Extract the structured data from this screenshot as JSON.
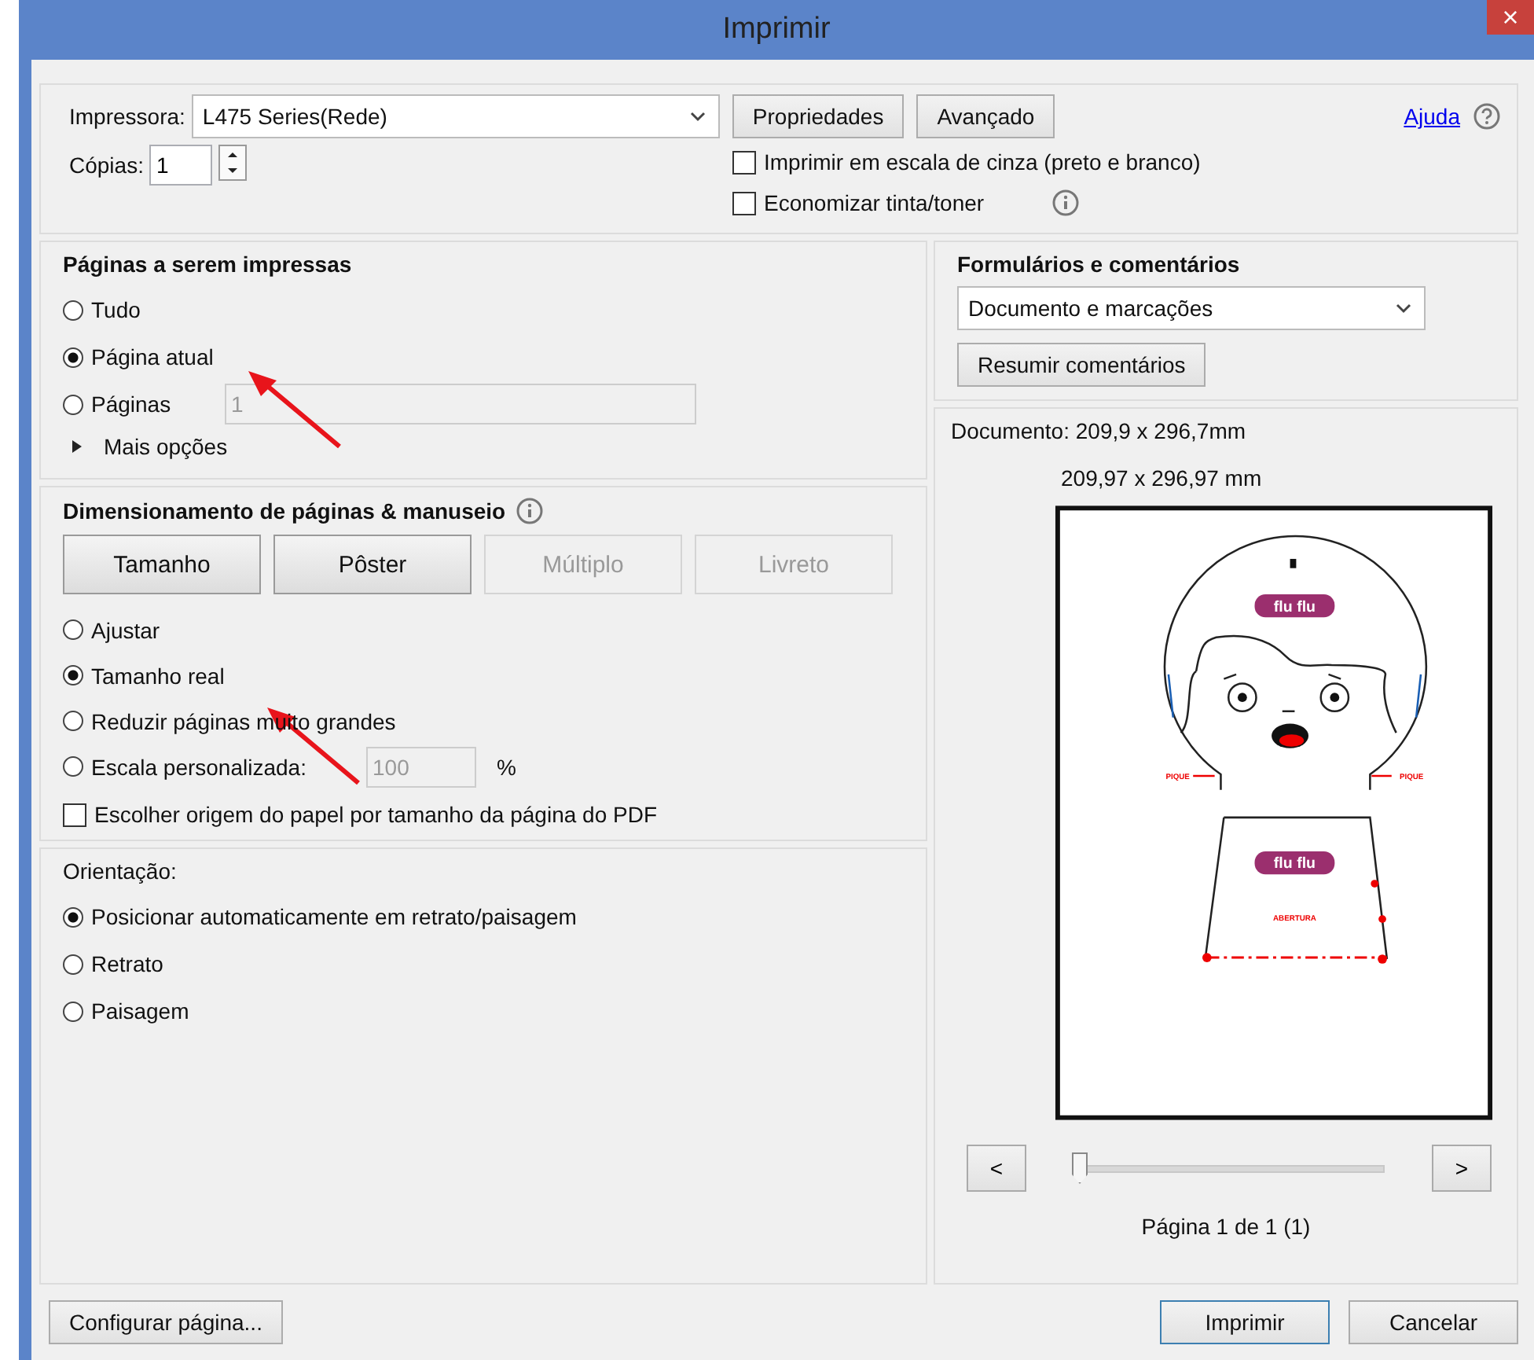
{
  "window": {
    "title": "Imprimir",
    "close": "×"
  },
  "printer": {
    "label": "Impressora:",
    "value": "L475 Series(Rede)",
    "buttons": [
      "Propriedades",
      "Avançado"
    ],
    "help": "Ajuda"
  },
  "copies": {
    "label": "Cópias:",
    "value": "1"
  },
  "options": [
    {
      "label": "Imprimir em escala de cinza (preto e branco)",
      "checked": false,
      "info": false
    },
    {
      "label": "Economizar tinta/toner",
      "checked": false,
      "info": true
    }
  ],
  "pages": {
    "title": "Páginas a serem impressas",
    "options": [
      {
        "label": "Tudo",
        "selected": false
      },
      {
        "label": "Página atual",
        "selected": true
      },
      {
        "label": "Páginas",
        "selected": false,
        "field": "1"
      }
    ],
    "more": "Mais opções",
    "expanded": false
  },
  "sizing": {
    "title": "Dimensionamento de páginas & manuseio",
    "buttons": [
      {
        "label": "Tamanho",
        "disabled": false
      },
      {
        "label": "Pôster",
        "disabled": false
      },
      {
        "label": "Múltiplo",
        "disabled": true
      },
      {
        "label": "Livreto",
        "disabled": true
      }
    ],
    "options": [
      {
        "label": "Ajustar",
        "selected": false
      },
      {
        "label": "Tamanho real",
        "selected": true
      },
      {
        "label": "Reduzir páginas muito grandes",
        "selected": false
      },
      {
        "label": "Escala personalizada:",
        "selected": false,
        "field": "100",
        "unit": "%"
      }
    ],
    "paper_source": {
      "label": "Escolher origem do papel por tamanho da página do PDF",
      "checked": false
    }
  },
  "orientation": {
    "title": "Orientação:",
    "options": [
      {
        "label": "Posicionar automaticamente em retrato/paisagem",
        "selected": true
      },
      {
        "label": "Retrato",
        "selected": false
      },
      {
        "label": "Paisagem",
        "selected": false
      }
    ]
  },
  "forms": {
    "title": "Formulários e comentários",
    "value": "Documento e marcações",
    "button": "Resumir comentários"
  },
  "preview": {
    "document": "Documento: 209,9 x 296,7mm",
    "paper": "209,97 x 296,97 mm",
    "logos": [
      "flu flu",
      "flu flu"
    ],
    "labels": [
      "PIQUE",
      "PIQUE",
      "ABERTURA"
    ],
    "prev": "<",
    "next": ">",
    "level": 0,
    "page": "Página 1 de 1 (1)"
  },
  "footer": {
    "setup": "Configurar página...",
    "print": "Imprimir",
    "cancel": "Cancelar"
  }
}
